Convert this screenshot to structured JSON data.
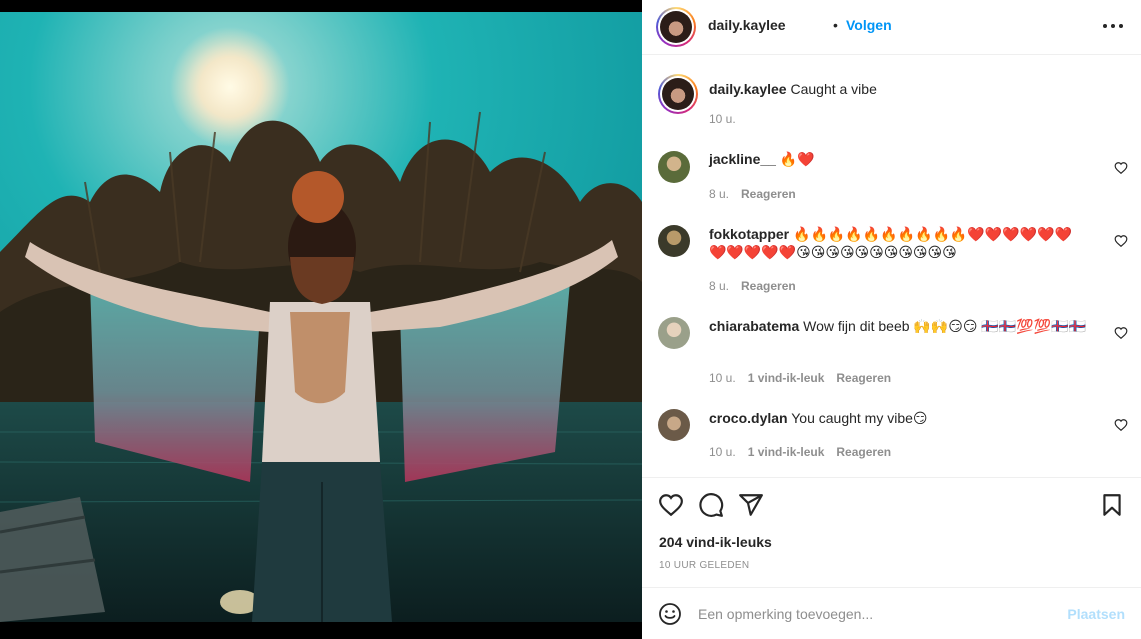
{
  "post": {
    "username": "daily.kaylee",
    "separator": "•",
    "follow_label": "Volgen",
    "more_icon": "more-horizontal-icon",
    "photo_alt": "woman with arms spread"
  },
  "caption": {
    "username": "daily.kaylee",
    "text": "Caught a vibe",
    "time": "10 u."
  },
  "comments": [
    {
      "username": "jackline__",
      "text": "🔥❤️",
      "time": "8 u.",
      "likes": "",
      "reply": "Reageren",
      "avatar_color": "#5a6b3a"
    },
    {
      "username": "fokkotapper",
      "text": "🔥🔥🔥🔥🔥🔥🔥🔥🔥🔥❤️❤️❤️❤️❤️❤️❤️❤️❤️❤️❤️😘😘😘😘😘😘😘😘😘😘😘",
      "time": "8 u.",
      "likes": "",
      "reply": "Reageren",
      "avatar_color": "#3b3a2a"
    },
    {
      "username": "chiarabatema",
      "text": "Wow fijn dit beeb 🙌🙌😏😏 🇫🇴🇫🇴💯💯🇫🇴🇫🇴",
      "time": "10 u.",
      "likes": "1 vind-ik-leuk",
      "reply": "Reageren",
      "avatar_color": "#9aa08a"
    },
    {
      "username": "croco.dylan",
      "text": "You caught my vibe😏",
      "time": "10 u.",
      "likes": "1 vind-ik-leuk",
      "reply": "Reageren",
      "avatar_color": "#6b5a48"
    }
  ],
  "actions": {
    "like_icon": "heart-icon",
    "comment_icon": "comment-icon",
    "share_icon": "send-icon",
    "save_icon": "bookmark-icon",
    "likes_text": "204 vind-ik-leuks",
    "time_text": "10 UUR GELEDEN"
  },
  "add_comment": {
    "placeholder": "Een opmerking toevoegen...",
    "post_label": "Plaatsen",
    "emoji_icon": "smiley-icon"
  },
  "colors": {
    "link_blue": "#0095f6",
    "post_disabled": "#b2dffc",
    "muted": "#8e8e8e",
    "text": "#262626"
  }
}
